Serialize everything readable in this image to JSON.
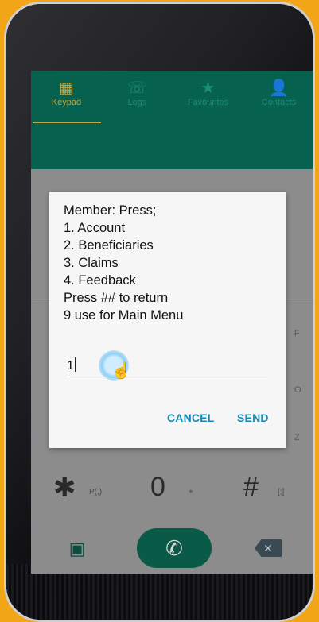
{
  "tabs": [
    {
      "label": "Keypad",
      "icon": "keypad-icon",
      "glyph": "▦",
      "active": true
    },
    {
      "label": "Logs",
      "icon": "call-log-icon",
      "glyph": "☏",
      "active": false
    },
    {
      "label": "Favourites",
      "icon": "star-icon",
      "glyph": "★",
      "active": false
    },
    {
      "label": "Contacts",
      "icon": "person-icon",
      "glyph": "👤",
      "active": false
    }
  ],
  "dialog": {
    "message_lines": [
      "Member: Press;",
      "1. Account",
      "2. Beneficiaries",
      "3. Claims",
      "4. Feedback",
      "Press ## to return",
      "9 use for Main Menu"
    ],
    "input_value": "1",
    "cancel_label": "CANCEL",
    "send_label": "SEND"
  },
  "keypad": {
    "star": "✱",
    "star_sub": "P(,)",
    "zero": "0",
    "zero_sub": "+",
    "hash": "#",
    "hash_sub": "[;]",
    "side_letters": [
      "F",
      "O",
      "Z"
    ]
  },
  "colors": {
    "frame_background": "#f2a516",
    "tabbar": "#06614f",
    "accent": "#1589b5",
    "active_tab": "#b7a84a",
    "call_button": "#0a5a48"
  }
}
